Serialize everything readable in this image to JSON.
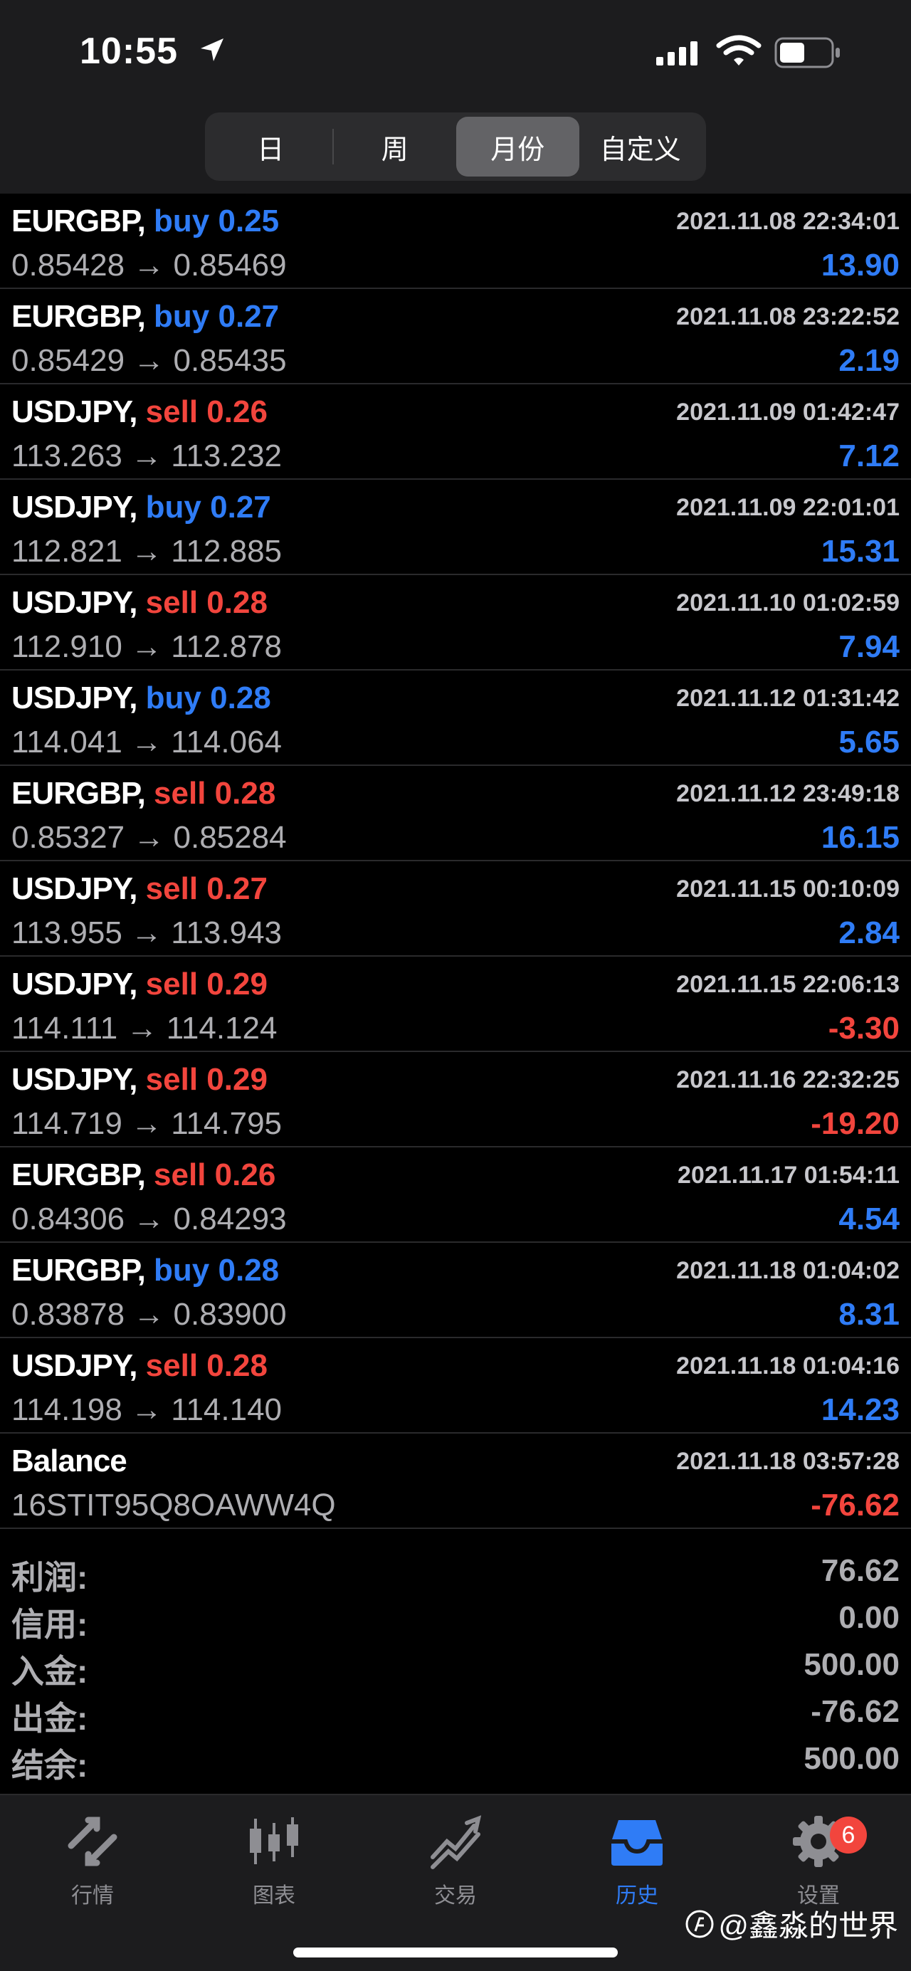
{
  "status_bar": {
    "time": "10:55"
  },
  "segments": [
    {
      "label": "日",
      "active": false
    },
    {
      "label": "周",
      "active": false
    },
    {
      "label": "月份",
      "active": true
    },
    {
      "label": "自定义",
      "active": false
    }
  ],
  "trades": [
    {
      "symbol": "EURGBP,",
      "side": "buy",
      "lots": "0.25",
      "time": "2021.11.08 22:34:01",
      "prices": "0.85428 → 0.85469",
      "profit": "13.90",
      "sign": "pos"
    },
    {
      "symbol": "EURGBP,",
      "side": "buy",
      "lots": "0.27",
      "time": "2021.11.08 23:22:52",
      "prices": "0.85429 → 0.85435",
      "profit": "2.19",
      "sign": "pos"
    },
    {
      "symbol": "USDJPY,",
      "side": "sell",
      "lots": "0.26",
      "time": "2021.11.09 01:42:47",
      "prices": "113.263 → 113.232",
      "profit": "7.12",
      "sign": "pos"
    },
    {
      "symbol": "USDJPY,",
      "side": "buy",
      "lots": "0.27",
      "time": "2021.11.09 22:01:01",
      "prices": "112.821 → 112.885",
      "profit": "15.31",
      "sign": "pos"
    },
    {
      "symbol": "USDJPY,",
      "side": "sell",
      "lots": "0.28",
      "time": "2021.11.10 01:02:59",
      "prices": "112.910 → 112.878",
      "profit": "7.94",
      "sign": "pos"
    },
    {
      "symbol": "USDJPY,",
      "side": "buy",
      "lots": "0.28",
      "time": "2021.11.12 01:31:42",
      "prices": "114.041 → 114.064",
      "profit": "5.65",
      "sign": "pos"
    },
    {
      "symbol": "EURGBP,",
      "side": "sell",
      "lots": "0.28",
      "time": "2021.11.12 23:49:18",
      "prices": "0.85327 → 0.85284",
      "profit": "16.15",
      "sign": "pos"
    },
    {
      "symbol": "USDJPY,",
      "side": "sell",
      "lots": "0.27",
      "time": "2021.11.15 00:10:09",
      "prices": "113.955 → 113.943",
      "profit": "2.84",
      "sign": "pos"
    },
    {
      "symbol": "USDJPY,",
      "side": "sell",
      "lots": "0.29",
      "time": "2021.11.15 22:06:13",
      "prices": "114.111 → 114.124",
      "profit": "-3.30",
      "sign": "neg"
    },
    {
      "symbol": "USDJPY,",
      "side": "sell",
      "lots": "0.29",
      "time": "2021.11.16 22:32:25",
      "prices": "114.719 → 114.795",
      "profit": "-19.20",
      "sign": "neg"
    },
    {
      "symbol": "EURGBP,",
      "side": "sell",
      "lots": "0.26",
      "time": "2021.11.17 01:54:11",
      "prices": "0.84306 → 0.84293",
      "profit": "4.54",
      "sign": "pos"
    },
    {
      "symbol": "EURGBP,",
      "side": "buy",
      "lots": "0.28",
      "time": "2021.11.18 01:04:02",
      "prices": "0.83878 → 0.83900",
      "profit": "8.31",
      "sign": "pos"
    },
    {
      "symbol": "USDJPY,",
      "side": "sell",
      "lots": "0.28",
      "time": "2021.11.18 01:04:16",
      "prices": "114.198 → 114.140",
      "profit": "14.23",
      "sign": "pos"
    }
  ],
  "balance": {
    "label": "Balance",
    "time": "2021.11.18 03:57:28",
    "comment": "16STIT95Q8OAWW4Q",
    "amount": "-76.62"
  },
  "summary": [
    {
      "label": "利润:",
      "value": "76.62"
    },
    {
      "label": "信用:",
      "value": "0.00"
    },
    {
      "label": "入金:",
      "value": "500.00"
    },
    {
      "label": "出金:",
      "value": "-76.62"
    },
    {
      "label": "结余:",
      "value": "500.00"
    }
  ],
  "tabs": [
    {
      "label": "行情",
      "icon": "quotes-icon",
      "active": false
    },
    {
      "label": "图表",
      "icon": "chart-icon",
      "active": false
    },
    {
      "label": "交易",
      "icon": "trade-icon",
      "active": false
    },
    {
      "label": "历史",
      "icon": "history-icon",
      "active": true
    },
    {
      "label": "设置",
      "icon": "settings-icon",
      "active": false,
      "badge": "6"
    }
  ],
  "watermark": "@鑫淼的世界",
  "colors": {
    "buy": "#2f7cf6",
    "sell": "#f2453d",
    "accent": "#2f7cf6"
  }
}
